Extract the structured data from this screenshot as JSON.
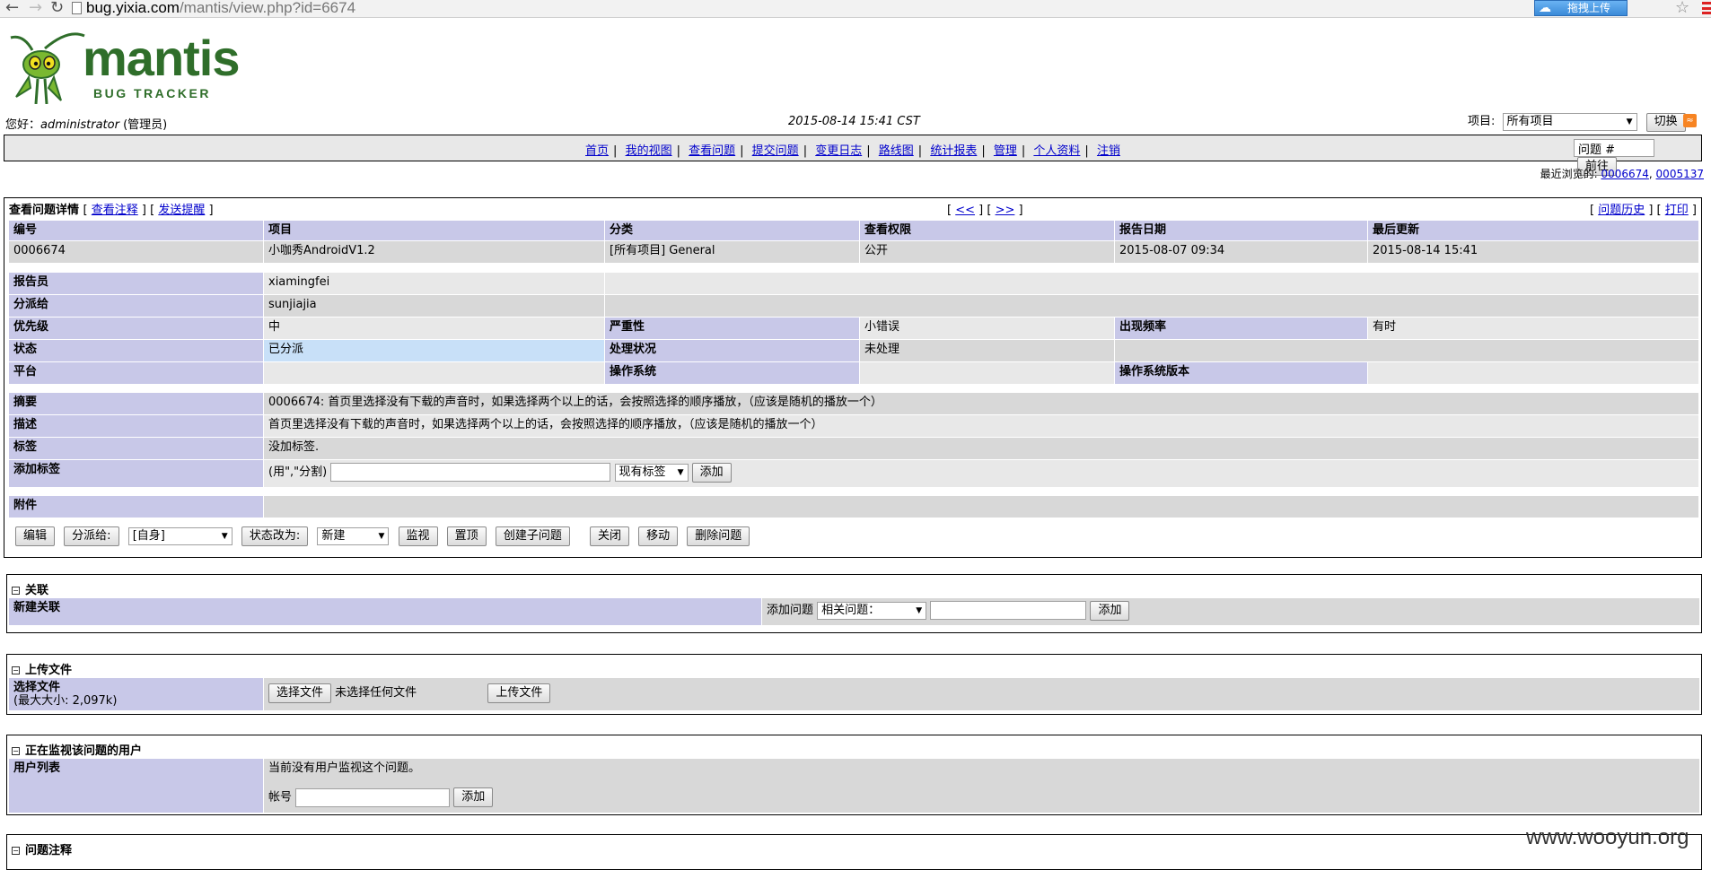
{
  "browser": {
    "url_host": "bug.yixia.com",
    "url_path": "/mantis/view.php?id=6674",
    "upload_btn": "拖拽上传"
  },
  "logo": {
    "word": "mantis",
    "sub": "BUG TRACKER"
  },
  "header": {
    "greet_prefix": "您好：",
    "user": "administrator",
    "role": "(管理员)",
    "datetime": "2015-08-14 15:41 CST",
    "project_label": "项目:",
    "project_value": "所有项目",
    "switch_btn": "切换"
  },
  "menu": {
    "items": [
      "首页",
      "我的视图",
      "查看问题",
      "提交问题",
      "变更日志",
      "路线图",
      "统计报表",
      "管理",
      "个人资料",
      "注销"
    ],
    "jump_placeholder": "问题 #",
    "jump_btn": "前往"
  },
  "recent": {
    "label": "最近浏览的:",
    "items": [
      "0006674",
      "0005137"
    ]
  },
  "issue": {
    "title": "查看问题详情",
    "view_notes": "查看注释",
    "send_reminder": "发送提醒",
    "prev": "<<",
    "next": ">>",
    "history": "问题历史",
    "print": "打印",
    "headers": [
      "编号",
      "项目",
      "分类",
      "查看权限",
      "报告日期",
      "最后更新"
    ],
    "values": [
      "0006674",
      "小咖秀AndroidV1.2",
      "[所有项目] General",
      "公开",
      "2015-08-07 09:34",
      "2015-08-14 15:41"
    ],
    "reporter_label": "报告员",
    "reporter": "xiamingfei",
    "handler_label": "分派给",
    "handler": "sunjiajia",
    "priority_label": "优先级",
    "priority": "中",
    "severity_label": "严重性",
    "severity": "小错误",
    "repro_label": "出现频率",
    "repro": "有时",
    "status_label": "状态",
    "status": "已分派",
    "resolution_label": "处理状况",
    "resolution": "未处理",
    "platform_label": "平台",
    "os_label": "操作系统",
    "os_ver_label": "操作系统版本",
    "summary_label": "摘要",
    "summary": "0006674: 首页里选择没有下载的声音时，如果选择两个以上的话，会按照选择的顺序播放，（应该是随机的播放一个）",
    "desc_label": "描述",
    "desc": "首页里选择没有下载的声音时，如果选择两个以上的话，会按照选择的顺序播放，（应该是随机的播放一个）",
    "tags_label": "标签",
    "tags": "没加标签.",
    "addtag_label": "添加标签",
    "addtag_hint": "(用\",\"分割)",
    "existing_tags": "现有标签",
    "addtag_btn": "添加",
    "attach_label": "附件",
    "actions": {
      "edit": "编辑",
      "assign": "分派给:",
      "assign_sel": "[自身]",
      "status_change": "状态改为:",
      "status_sel": "新建",
      "monitor": "监视",
      "stick": "置顶",
      "clone": "创建子问题",
      "close": "关闭",
      "move": "移动",
      "delete": "删除问题"
    }
  },
  "relations": {
    "title": "关联",
    "new_label": "新建关联",
    "add_label": "添加问题",
    "rel_sel": "相关问题：",
    "add_btn": "添加"
  },
  "upload": {
    "title": "上传文件",
    "choose_label": "选择文件",
    "max_size": "(最大大小: 2,097k)",
    "choose_btn": "选择文件",
    "no_file": "未选择任何文件",
    "upload_btn": "上传文件"
  },
  "monitor": {
    "title": "正在监视该问题的用户",
    "list_label": "用户列表",
    "none": "当前没有用户监视这个问题。",
    "account_label": "帐号",
    "add_btn": "添加"
  },
  "notes": {
    "title": "问题注释"
  },
  "watermark": "www.wooyun.org"
}
